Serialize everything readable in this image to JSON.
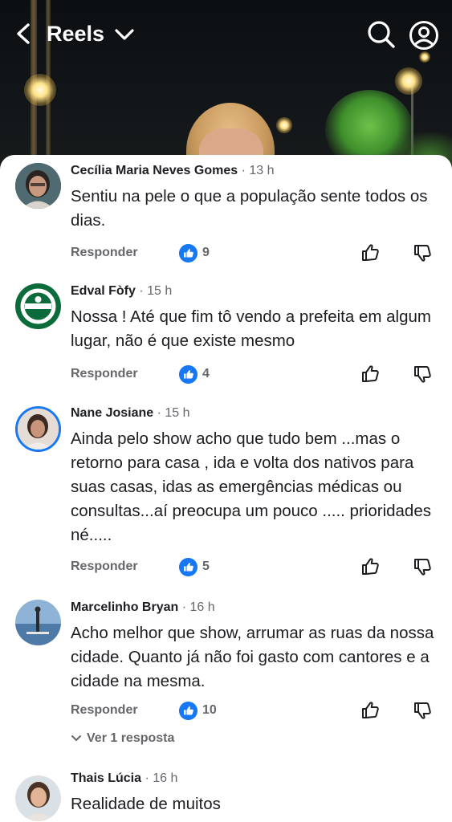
{
  "header": {
    "title": "Reels",
    "back_icon": "back-arrow-icon",
    "dropdown_icon": "chevron-down-icon",
    "search_icon": "search-icon",
    "profile_icon": "profile-icon"
  },
  "comments": [
    {
      "author": "Cecília Maria Neves Gomes",
      "time": "13 h",
      "text": "Sentiu na pele o que a população sente todos os dias.",
      "reply_label": "Responder",
      "likes": "9"
    },
    {
      "author": "Edval Fòfy",
      "time": "15 h",
      "text": "Nossa ! Até que fim tô vendo a prefeita em algum lugar, não é que existe mesmo",
      "reply_label": "Responder",
      "likes": "4"
    },
    {
      "author": "Nane Josiane",
      "time": "15 h",
      "text": "Ainda pelo show  acho que tudo bem ...mas o retorno para casa  , ida e volta dos nativos para suas casas,  idas as emergências médicas ou consultas...aí preocupa um pouco ..... prioridades né.....",
      "reply_label": "Responder",
      "likes": "5"
    },
    {
      "author": "Marcelinho Bryan",
      "time": "16 h",
      "text": "Acho melhor que show, arrumar as ruas da nossa cidade. Quanto já não foi gasto com cantores e a cidade na mesma.",
      "reply_label": "Responder",
      "likes": "10",
      "replies_label": "Ver 1 resposta"
    },
    {
      "author": "Thais Lúcia",
      "time": "16 h",
      "text": "Realidade de muitos"
    }
  ],
  "separator": "·",
  "colors": {
    "accent": "#1877f2",
    "text": "#1c1e21",
    "muted": "#65676b"
  }
}
